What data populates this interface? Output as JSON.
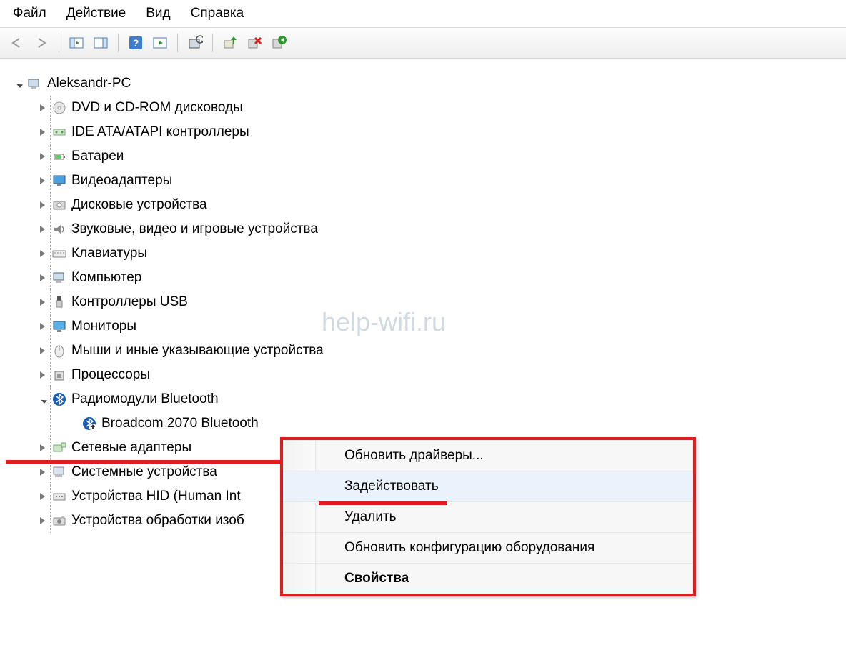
{
  "menubar": {
    "file": "Файл",
    "action": "Действие",
    "view": "Вид",
    "help": "Справка"
  },
  "tree": {
    "root": "Aleksandr-PC",
    "items": [
      {
        "label": "DVD и CD-ROM дисководы",
        "icon": "dvd"
      },
      {
        "label": "IDE ATA/ATAPI контроллеры",
        "icon": "ide"
      },
      {
        "label": "Батареи",
        "icon": "battery"
      },
      {
        "label": "Видеоадаптеры",
        "icon": "display"
      },
      {
        "label": "Дисковые устройства",
        "icon": "disk"
      },
      {
        "label": "Звуковые, видео и игровые устройства",
        "icon": "sound"
      },
      {
        "label": "Клавиатуры",
        "icon": "keyboard"
      },
      {
        "label": "Компьютер",
        "icon": "computer"
      },
      {
        "label": "Контроллеры USB",
        "icon": "usb"
      },
      {
        "label": "Мониторы",
        "icon": "monitor"
      },
      {
        "label": "Мыши и иные указывающие устройства",
        "icon": "mouse"
      },
      {
        "label": "Процессоры",
        "icon": "cpu"
      },
      {
        "label": "Радиомодули Bluetooth",
        "icon": "bluetooth",
        "expanded": true
      },
      {
        "label": "Broadcom 2070 Bluetooth",
        "icon": "bt-disabled",
        "level": 2
      },
      {
        "label": "Сетевые адаптеры",
        "icon": "network"
      },
      {
        "label": "Системные устройства",
        "icon": "system"
      },
      {
        "label": "Устройства HID (Human Int",
        "icon": "hid"
      },
      {
        "label": "Устройства обработки изоб",
        "icon": "imaging"
      }
    ]
  },
  "context_menu": {
    "update_drivers": "Обновить драйверы...",
    "enable": "Задействовать",
    "delete": "Удалить",
    "refresh_config": "Обновить конфигурацию оборудования",
    "properties": "Свойства"
  },
  "watermark": "help-wifi.ru"
}
